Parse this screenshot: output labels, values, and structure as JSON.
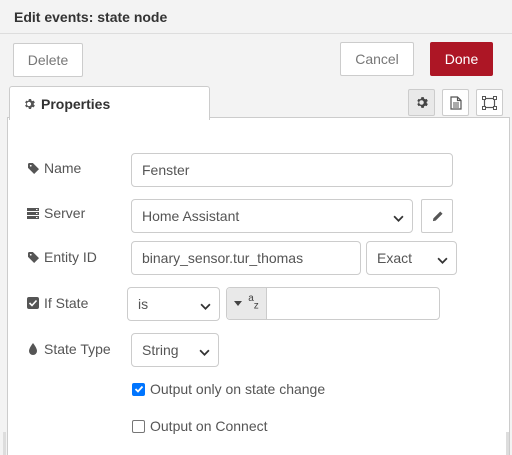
{
  "tray": {
    "title": "Edit events: state node"
  },
  "toolbar": {
    "delete_label": "Delete",
    "cancel_label": "Cancel",
    "done_label": "Done"
  },
  "tabs": {
    "properties_label": "Properties"
  },
  "form": {
    "name": {
      "label": "Name",
      "value": "Fenster"
    },
    "server": {
      "label": "Server",
      "value": "Home Assistant"
    },
    "entity_id": {
      "label": "Entity ID",
      "value": "binary_sensor.tur_thomas",
      "match_value": "Exact"
    },
    "if_state": {
      "label": "If State",
      "operator": "is",
      "type_glyph": "a",
      "type_glyph_sub": "z",
      "value": ""
    },
    "state_type": {
      "label": "State Type",
      "value": "String"
    },
    "output_only_on_change": {
      "label": "Output only on state change",
      "checked": true
    },
    "output_on_connect": {
      "label": "Output on Connect",
      "checked": false
    }
  },
  "colors": {
    "done": "#ad1625",
    "checkbox": "#0075ff"
  }
}
